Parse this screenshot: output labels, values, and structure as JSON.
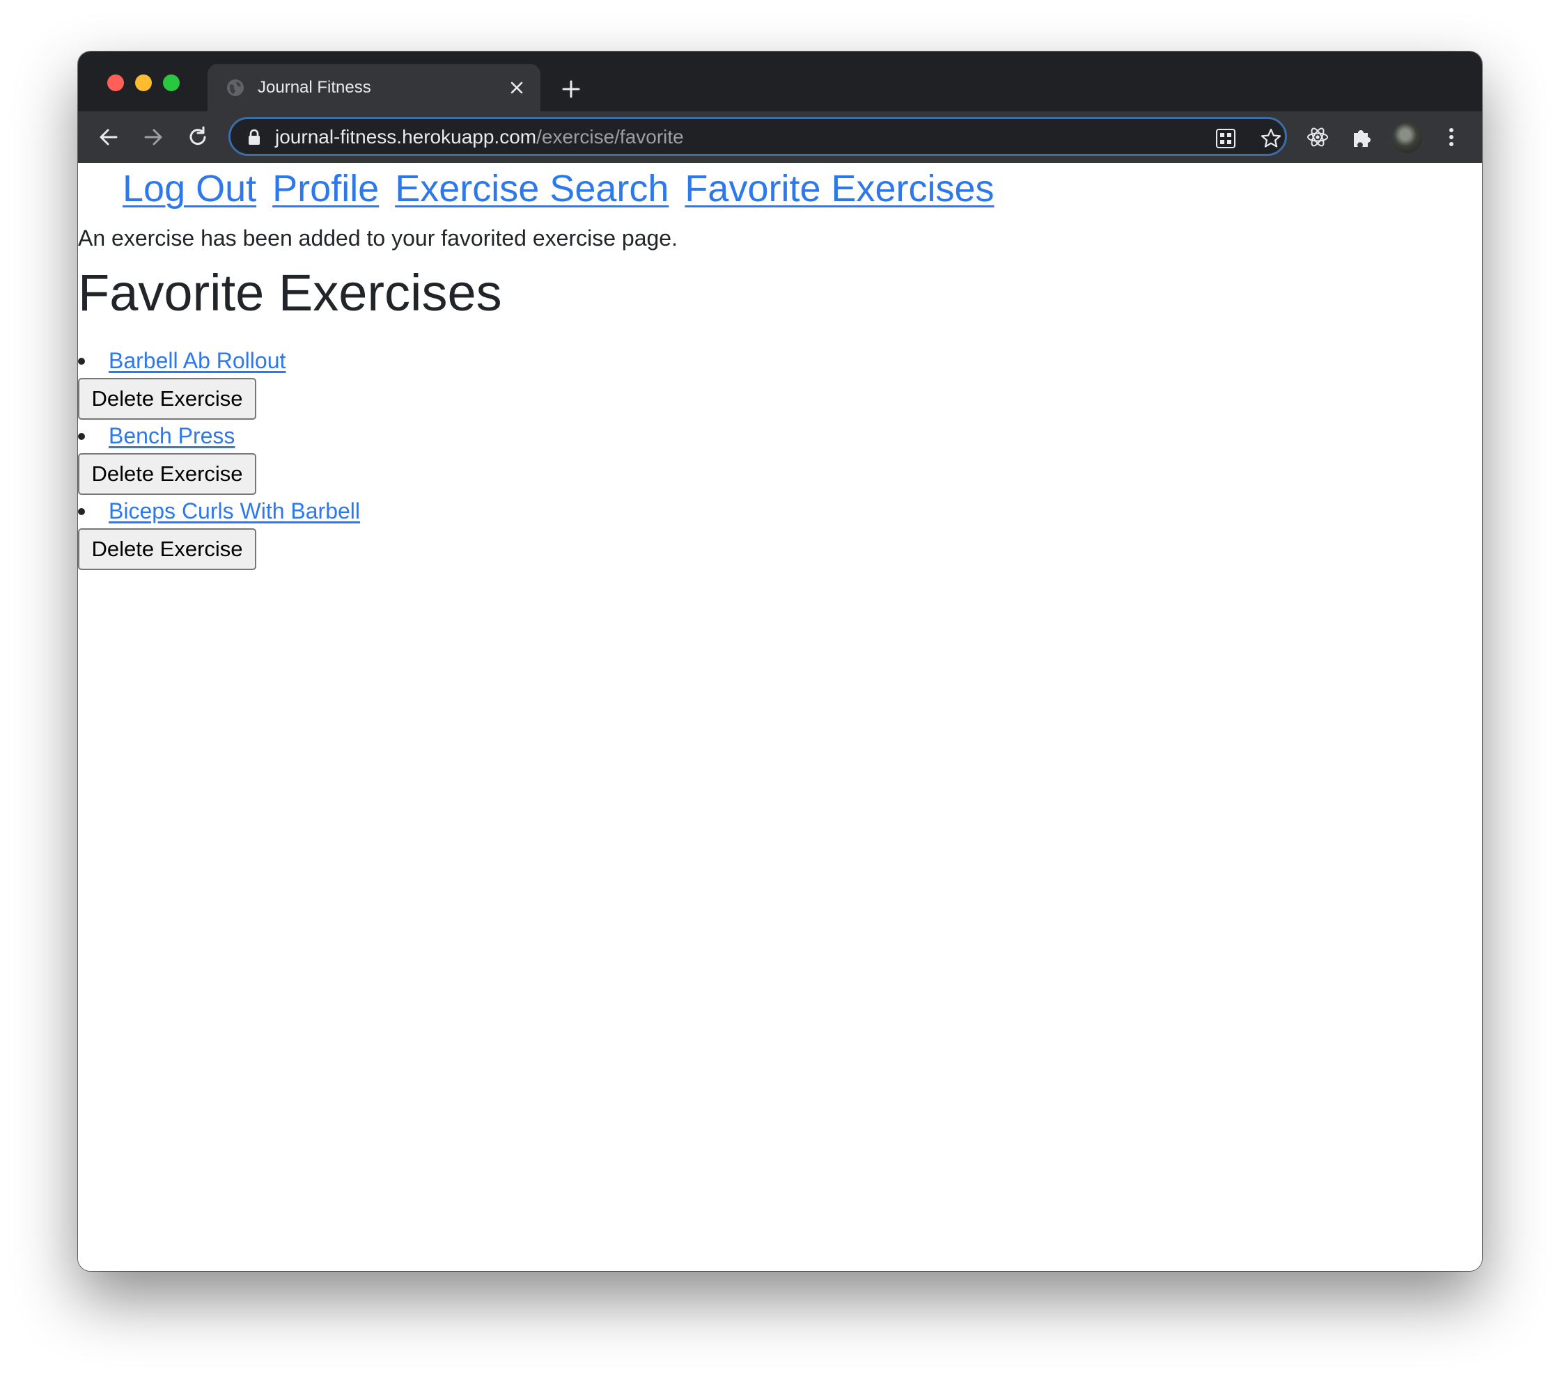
{
  "browser": {
    "tab_title": "Journal Fitness",
    "url_host": "journal-fitness.herokuapp.com",
    "url_path": "/exercise/favorite",
    "icons": [
      "globe-icon",
      "close-icon",
      "plus-icon",
      "back-arrow-icon",
      "forward-arrow-icon",
      "reload-icon",
      "lock-icon",
      "qr-code-icon",
      "star-icon",
      "react-devtools-icon",
      "puzzle-icon",
      "kebab-menu-icon"
    ],
    "colors": {
      "frame": "#202124",
      "tab": "#35363a",
      "omnibox_border": "#3b6ea8"
    }
  },
  "nav": {
    "logout": "Log Out",
    "profile": "Profile",
    "exercise_search": "Exercise Search",
    "favorite_exercises": "Favorite Exercises"
  },
  "flash_message": "An exercise has been added to your favorited exercise page.",
  "page_title": "Favorite Exercises",
  "favorites": [
    {
      "name": "Barbell Ab Rollout",
      "button": "Delete Exercise"
    },
    {
      "name": "Bench Press",
      "button": "Delete Exercise"
    },
    {
      "name": "Biceps Curls With Barbell",
      "button": "Delete Exercise"
    }
  ],
  "colors": {
    "link": "#2d78eb",
    "text": "#212529"
  }
}
